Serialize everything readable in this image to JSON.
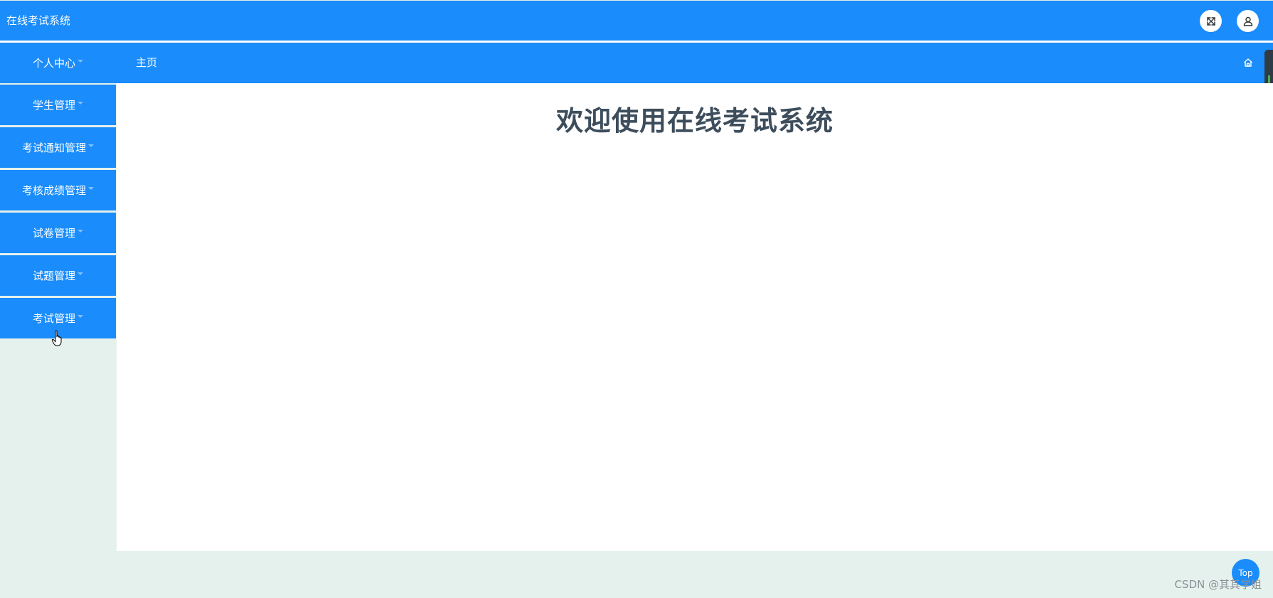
{
  "app": {
    "title": "在线考试系统"
  },
  "header": {
    "fullscreen_icon": "expand-arrows-icon",
    "user_icon": "user-icon"
  },
  "breadcrumb": {
    "label": "主页",
    "home_icon": "home-icon"
  },
  "sidebar": {
    "items": [
      {
        "label": "个人中心"
      },
      {
        "label": "学生管理"
      },
      {
        "label": "考试通知管理"
      },
      {
        "label": "考核成绩管理"
      },
      {
        "label": "试卷管理"
      },
      {
        "label": "试题管理"
      },
      {
        "label": "考试管理"
      }
    ]
  },
  "main": {
    "welcome": "欢迎使用在线考试系统"
  },
  "back_to_top": {
    "label": "Top"
  },
  "watermark": {
    "text": "CSDN @其其学姐"
  },
  "colors": {
    "primary": "#1a8cfb",
    "background": "#e5f1ec",
    "heading": "#3d4d5c"
  }
}
